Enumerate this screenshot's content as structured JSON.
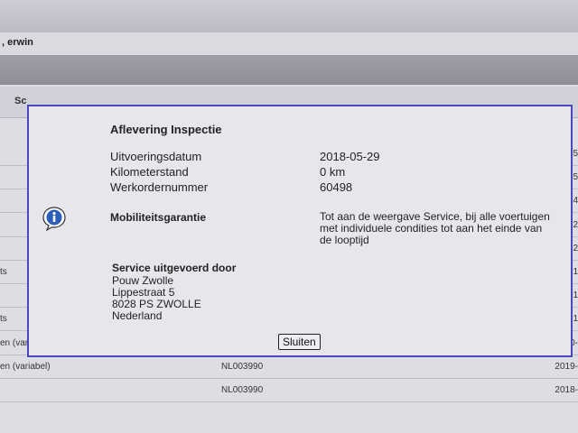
{
  "header": {
    "user": ", erwin"
  },
  "table": {
    "header_left": "Sc",
    "rows": [
      {
        "left": "",
        "mid": "",
        "right": "5"
      },
      {
        "left": "",
        "mid": "",
        "right": "5"
      },
      {
        "left": "",
        "mid": "",
        "right": "4"
      },
      {
        "left": "",
        "mid": "",
        "right": "2"
      },
      {
        "left": "",
        "mid": "",
        "right": "2"
      },
      {
        "left": "ts",
        "mid": "",
        "right": "1"
      },
      {
        "left": "",
        "mid": "",
        "right": "1"
      },
      {
        "left": "ts",
        "mid": "",
        "right": "1"
      },
      {
        "left": "en (varia",
        "mid": "",
        "right": "0-"
      },
      {
        "left": "en (variabel)",
        "mid": "NL003990",
        "right": "2019-"
      },
      {
        "left": "",
        "mid": "NL003990",
        "right": "2018-"
      }
    ]
  },
  "dialog": {
    "title": "Aflevering Inspectie",
    "fields": [
      {
        "label": "Uitvoeringsdatum",
        "value": "2018-05-29"
      },
      {
        "label": "Kilometerstand",
        "value": "0 km"
      },
      {
        "label": "Werkordernummer",
        "value": "60498"
      }
    ],
    "mobility_label": "Mobiliteitsgarantie",
    "mobility_text": "Tot aan de weergave Service, bij alle voertuigen met individuele condities tot aan het einde van de looptijd",
    "service_title": "Service uitgevoerd door",
    "service_lines": [
      "Pouw Zwolle",
      "Lippestraat 5",
      "8028 PS ZWOLLE",
      "Nederland"
    ],
    "close_label": "Sluiten",
    "icon": "info-icon",
    "accent": "#4a47c4"
  }
}
